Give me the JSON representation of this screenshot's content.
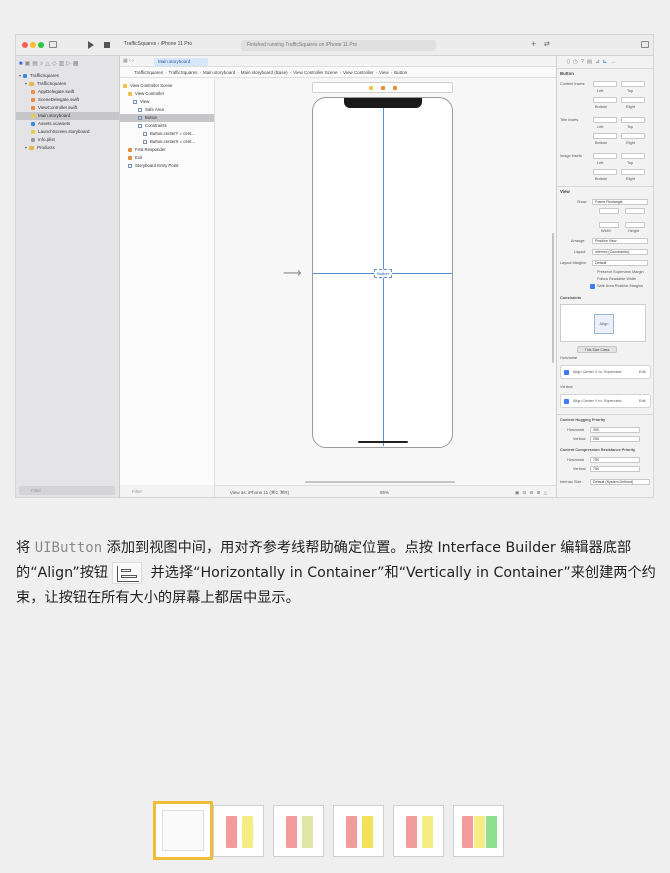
{
  "xcode": {
    "scheme_project": "TrafficSquares",
    "scheme_device": "iPhone 11 Pro",
    "activity": "Finished running TrafficSquares on iPhone 11 Pro",
    "editor_tab": "Main.storyboard",
    "breadcrumbs": [
      "TrafficSquares",
      "TrafficSquares",
      "Main.storyboard",
      "Main.storyboard (Base)",
      "View Controller Scene",
      "View Controller",
      "View",
      "Button"
    ],
    "navigator": [
      {
        "label": "TrafficSquares",
        "kind": "project",
        "indent": 0
      },
      {
        "label": "TrafficSquares",
        "kind": "folder",
        "indent": 1
      },
      {
        "label": "AppDelegate.swift",
        "kind": "swift",
        "indent": 2
      },
      {
        "label": "SceneDelegate.swift",
        "kind": "swift",
        "indent": 2
      },
      {
        "label": "ViewController.swift",
        "kind": "swift",
        "indent": 2
      },
      {
        "label": "Main.storyboard",
        "kind": "storyboard",
        "indent": 2,
        "selected": true
      },
      {
        "label": "Assets.xcassets",
        "kind": "asset",
        "indent": 2
      },
      {
        "label": "LaunchScreen.storyboard",
        "kind": "storyboard",
        "indent": 2
      },
      {
        "label": "Info.plist",
        "kind": "plist",
        "indent": 2
      },
      {
        "label": "Products",
        "kind": "folder",
        "indent": 1
      }
    ],
    "nav_filter": "Filter",
    "outline": [
      {
        "label": "View Controller Scene",
        "indent": 0,
        "kind": "scene"
      },
      {
        "label": "View Controller",
        "indent": 1,
        "kind": "vc"
      },
      {
        "label": "View",
        "indent": 2,
        "kind": "view"
      },
      {
        "label": "Safe Area",
        "indent": 3,
        "kind": "view"
      },
      {
        "label": "Button",
        "indent": 3,
        "kind": "view",
        "selected": true
      },
      {
        "label": "Constraints",
        "indent": 3,
        "kind": "view"
      },
      {
        "label": "Button.centerY = cent...",
        "indent": 4,
        "kind": "view"
      },
      {
        "label": "Button.centerX = cent...",
        "indent": 4,
        "kind": "view"
      },
      {
        "label": "First Responder",
        "indent": 1,
        "kind": "responder"
      },
      {
        "label": "Exit",
        "indent": 1,
        "kind": "exit"
      },
      {
        "label": "Storyboard Entry Point",
        "indent": 1,
        "kind": "entry"
      }
    ],
    "outline_filter": "Filter",
    "canvas_button_label": "Button",
    "view_as": "View as: iPhone 11 (⌘C ⌘R)",
    "zoom": "85%",
    "inspector": {
      "section_button": "Button",
      "content_insets": "Content Insets",
      "title_insets": "Title Insets",
      "image_insets": "Image Insets",
      "left": "Left",
      "top": "Top",
      "bottom": "Bottom",
      "right": "Right",
      "section_view": "View",
      "show_label": "Show",
      "show_value": "Frame Rectangle",
      "width": "Width",
      "height": "Height",
      "arrange_label": "Arrange",
      "arrange_value": "Position View",
      "layout_label": "Layout",
      "layout_value": "Inferred (Constraints)",
      "layout_margins_label": "Layout Margins",
      "layout_margins_value": "Default",
      "preserve_superview": "Preserve Superview Margin",
      "follow_readable": "Follow Readable Width",
      "safe_area": "Safe Area Relative Margins",
      "constraints_title": "Constraints",
      "filter_btn": "This Size Class",
      "horizontal_title": "Horizontal",
      "align_center_x": "Align Center X to: Superview",
      "edit_label": "Edit",
      "vertical_title": "Vertical",
      "align_center_y": "Align Center Y to: Superview",
      "hugging_title": "Content Hugging Priority",
      "compression_title": "Content Compression Resistance Priority",
      "horizontal": "Horizontal",
      "vertical": "Vertical",
      "priority_250": "250",
      "priority_750": "750",
      "intrinsic_label": "Intrinsic Size",
      "intrinsic_value": "Default (System Defined)"
    }
  },
  "caption": {
    "part1": "将 ",
    "code": "UIButton",
    "part2": " 添加到视图中间，用对齐参考线帮助确定位置。点按 Interface Builder 编辑器底部的“Align”按钮",
    "part3": " 并选择“Horizontally in Container”和“Vertically in Container”来创建两个约束，让按钮在所有大小的屏幕上都居中显示。"
  },
  "thumbnails": [
    {
      "active": true,
      "bars": []
    },
    {
      "active": false,
      "bars": [
        "#f19b9b",
        "#f6ec84"
      ]
    },
    {
      "active": false,
      "bars": [
        "#f19b9b",
        "#dfe6a6"
      ]
    },
    {
      "active": false,
      "bars": [
        "#f19b9b",
        "#f3e15b"
      ]
    },
    {
      "active": false,
      "bars": [
        "#f19b9b",
        "#f6ec84"
      ]
    },
    {
      "active": false,
      "bars": [
        "#f19b9b",
        "#f6ec84",
        "#8ee08e"
      ]
    }
  ]
}
